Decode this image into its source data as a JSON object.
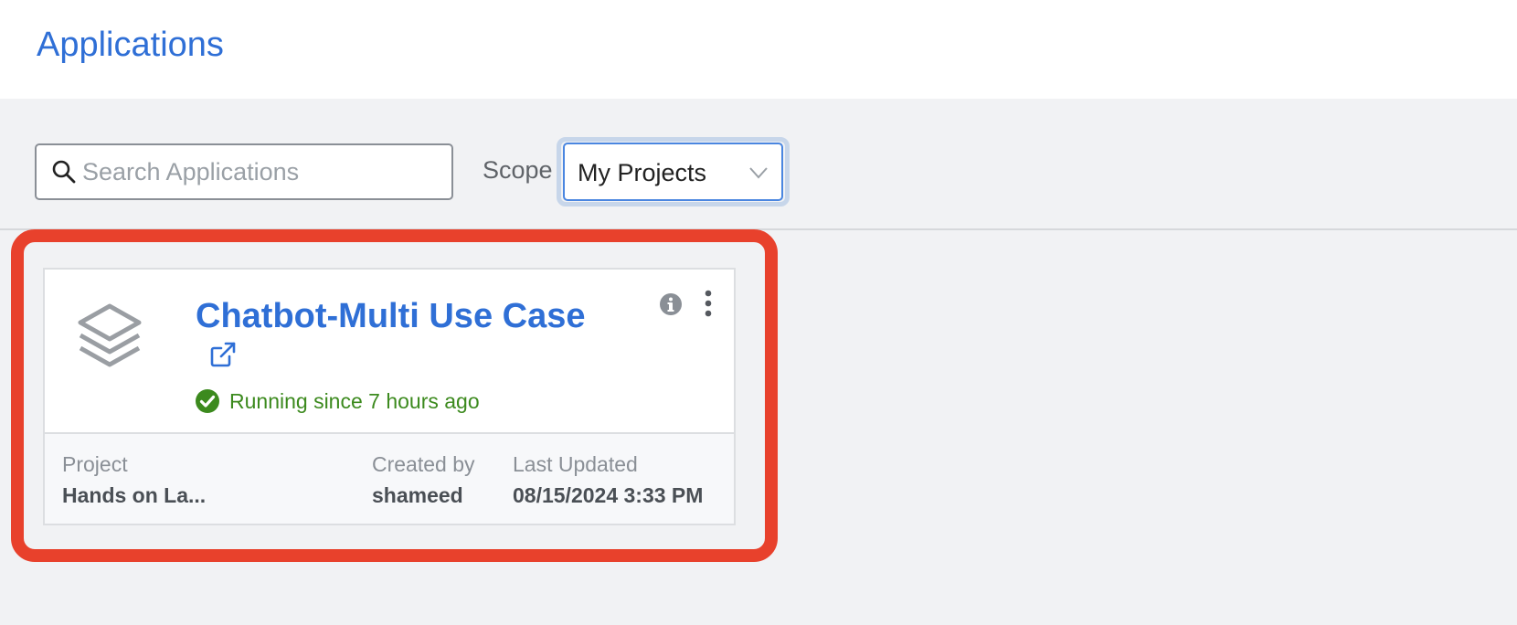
{
  "header": {
    "title": "Applications"
  },
  "toolbar": {
    "search_placeholder": "Search Applications",
    "scope_label": "Scope",
    "scope_value": "My Projects"
  },
  "application_card": {
    "title": "Chatbot-Multi Use Case",
    "status": "Running since 7 hours ago",
    "status_color": "#3c8a1e",
    "project_label": "Project",
    "project_value": "Hands on La...",
    "created_by_label": "Created by",
    "created_by_value": "shameed",
    "last_updated_label": "Last Updated",
    "last_updated_value": "08/15/2024 3:33 PM"
  },
  "colors": {
    "accent": "#2f6fd6",
    "highlight": "#e8412c",
    "background": "#f1f2f4"
  },
  "icons": [
    "search-icon",
    "chevron-down-icon",
    "layers-icon",
    "external-link-icon",
    "info-icon",
    "more-vertical-icon",
    "check-circle-icon"
  ]
}
